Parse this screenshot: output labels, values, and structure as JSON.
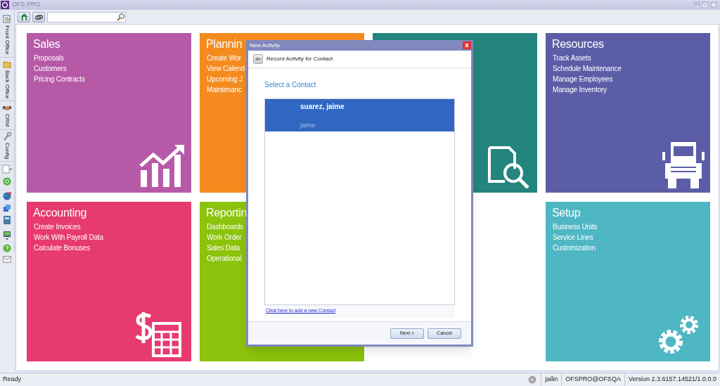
{
  "window": {
    "title": "OFS PRO"
  },
  "sidebar": {
    "tabs": [
      {
        "label": "Front Office",
        "selected": false
      },
      {
        "label": "Back Office",
        "selected": false
      },
      {
        "label": "CRM",
        "selected": false
      },
      {
        "label": "Config",
        "selected": false
      }
    ]
  },
  "tiles": [
    {
      "kind": "chart",
      "title": "Sales",
      "color": "#b65aa8",
      "items": [
        "Proposals",
        "Customers",
        "Pricing Contracts"
      ]
    },
    {
      "kind": "plain",
      "title": "Plannin",
      "color": "#f58b1f",
      "items": [
        "Create Wor",
        "View Calend",
        "Upcoming J",
        "Maintenanc"
      ]
    },
    {
      "kind": "search",
      "color": "#23857d"
    },
    {
      "kind": "truck",
      "title": "Resources",
      "color": "#5b5ea6",
      "items": [
        "Track Assets",
        "Schedule Maintenance",
        "Manage Employees",
        "Manage Inventory"
      ]
    },
    {
      "kind": "calculator",
      "title": "Accounting",
      "color": "#e63a70",
      "items": [
        "Create Invoices",
        "Work With Payroll Data",
        "Calculate Bonuses"
      ]
    },
    {
      "kind": "plain",
      "title": "Reportin",
      "color": "#8cc30c",
      "items": [
        "Dashboards",
        "Work Order",
        "Sales Data",
        "Operational"
      ]
    },
    {
      "kind": "gears",
      "title": "Setup",
      "color": "#4fb7c3",
      "items": [
        "Business Units",
        "Service Lines",
        "Customization"
      ]
    }
  ],
  "dialog": {
    "title": "New Activity",
    "header": "Record Activity for Contact",
    "heading": "Select a Contact",
    "contacts": [
      {
        "name": "suarez, jaime",
        "detail": "jaime",
        "selected": true
      }
    ],
    "link": "Click here to add a new Contact",
    "buttons": [
      "Next >",
      "Cancel"
    ]
  },
  "status_bar": {
    "status": "Ready",
    "user": "jailin",
    "database": "OFSPRO@OFSQA",
    "version": "Version 2.3.6157.14521/1.0.0.0"
  }
}
